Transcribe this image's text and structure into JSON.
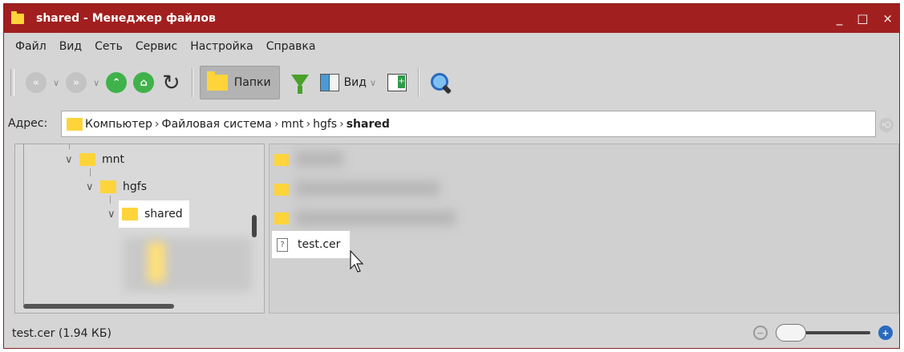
{
  "window": {
    "title": "shared - Менеджер файлов",
    "controls": {
      "minimize": "_",
      "maximize": "□",
      "close": "×"
    }
  },
  "menu": [
    "Файл",
    "Вид",
    "Сеть",
    "Сервис",
    "Настройка",
    "Справка"
  ],
  "toolbar": {
    "folders_label": "Папки",
    "view_label": "Вид",
    "icons": [
      "back-icon",
      "forward-icon",
      "up-icon",
      "home-icon",
      "refresh-icon",
      "folder-icon",
      "filter-icon",
      "view-icon",
      "panel-icon",
      "search-icon"
    ]
  },
  "address": {
    "label": "Адрес:",
    "crumbs": [
      "Компьютер",
      "Файловая система",
      "mnt",
      "hgfs",
      "shared"
    ]
  },
  "tree": {
    "items": [
      {
        "label": "mnt"
      },
      {
        "label": "hgfs"
      },
      {
        "label": "shared",
        "selected": true
      }
    ]
  },
  "files": {
    "items": [
      {
        "name": "test.cer",
        "selected": true
      }
    ]
  },
  "status": {
    "text": "test.cer (1.94 КБ)",
    "zoom_level": 0
  },
  "colors": {
    "titlebar": "#a11f1f",
    "folder": "#ffd43a",
    "selection": "#ffffff"
  }
}
